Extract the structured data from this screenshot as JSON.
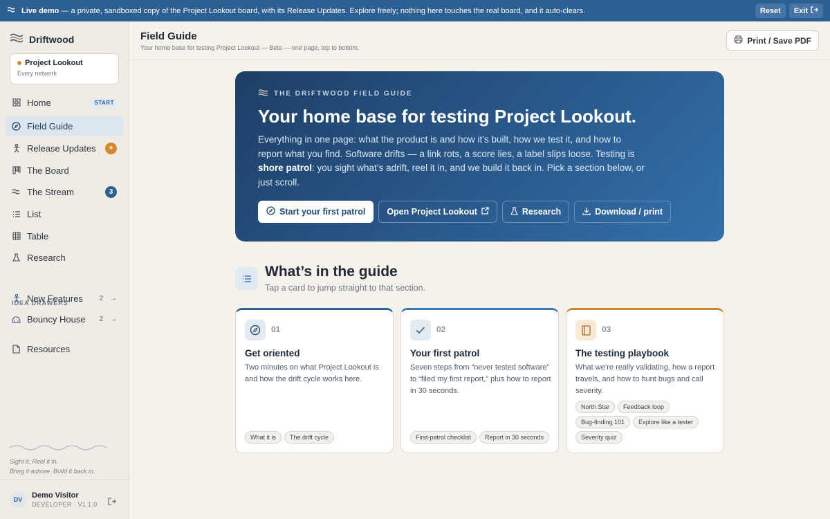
{
  "banner": {
    "lead": "Live demo",
    "message": " — a private, sandboxed copy of the Project Lookout board, with its Release Updates. Explore freely; nothing here touches the real board, and it auto-clears.",
    "reset_label": "Reset",
    "exit_label": "Exit"
  },
  "sidebar": {
    "brand": "Driftwood",
    "project": {
      "name": "Project Lookout",
      "sub": "Every network"
    },
    "items": [
      {
        "label": "Home",
        "icon": "grid-icon",
        "badge": "START"
      },
      {
        "label": "Field Guide",
        "icon": "compass-icon"
      },
      {
        "label": "Release Updates",
        "icon": "figure-icon"
      },
      {
        "label": "The Board",
        "icon": "board-icon"
      },
      {
        "label": "The Stream",
        "icon": "waves-icon",
        "count": "3"
      },
      {
        "label": "List",
        "icon": "list-icon"
      },
      {
        "label": "Table",
        "icon": "table-icon"
      },
      {
        "label": "Research",
        "icon": "flask-icon"
      }
    ],
    "section_label": "IDEA DRAWERS",
    "drawers": [
      {
        "label": "New Features",
        "count": "2"
      },
      {
        "label": "Bouncy House",
        "count": "2"
      }
    ],
    "resources": "Resources",
    "tagline_1": "Sight it. Reel it in.",
    "tagline_2": "Bring it ashore. Build it back in.",
    "user": {
      "initials": "DV",
      "name": "Demo Visitor",
      "role": "DEVELOPER · V1.1.0"
    }
  },
  "header": {
    "title": "Field Guide",
    "subtitle": "Your home base for testing Project Lookout — Beta — one page, top to bottom.",
    "print_label": "Print / Save PDF"
  },
  "hero": {
    "eyebrow": "THE DRIFTWOOD FIELD GUIDE",
    "title": "Your home base for testing Project Lookout.",
    "body_1": "Everything in one page: what the product is and how it’s built, how we test it, and how to report what you find. Software drifts — a link rots, a score lies, a label slips loose. Testing is ",
    "body_bold": "shore patrol",
    "body_2": ": you sight what’s adrift, reel it in, and we build it back in. Pick a section below, or just scroll.",
    "buttons": [
      "Start your first patrol",
      "Open Project Lookout",
      "Research",
      "Download / print"
    ]
  },
  "guide": {
    "title": "What’s in the guide",
    "subtitle": "Tap a card to jump straight to that section.",
    "cards": [
      {
        "num": "01",
        "title": "Get oriented",
        "desc": "Two minutes on what Project Lookout is and how the drift cycle works here.",
        "chips": [
          "What it is",
          "The drift cycle"
        ],
        "accent": "#2c5f93"
      },
      {
        "num": "02",
        "title": "Your first patrol",
        "desc": "Seven steps from “never tested software” to “filed my first report,” plus how to report in 30 seconds.",
        "chips": [
          "First-patrol checklist",
          "Report in 30 seconds"
        ],
        "accent": "#3a77b5"
      },
      {
        "num": "03",
        "title": "The testing playbook",
        "desc": "What we’re really validating, how a report travels, and how to hunt bugs and call severity.",
        "chips": [
          "North Star",
          "Feedback loop",
          "Bug-finding 101",
          "Explore like a tester",
          "Severity quiz"
        ],
        "accent": "#c9892f"
      }
    ]
  },
  "colors": {
    "accent": "#2c5f93",
    "warm": "#d48a2c"
  }
}
